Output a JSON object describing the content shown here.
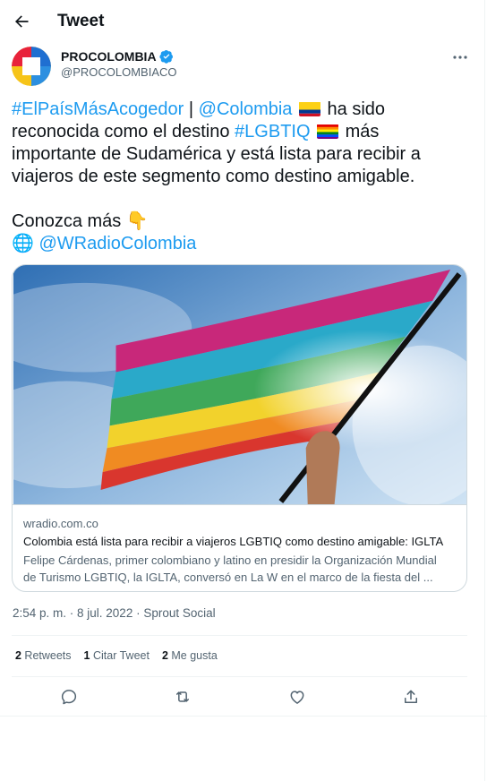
{
  "header": {
    "title": "Tweet",
    "back_icon": "arrow-left-icon"
  },
  "author": {
    "name": "PROCOLOMBIA",
    "handle": "@PROCOLOMBIACO",
    "verified": true
  },
  "tweet": {
    "l1_tag": "#ElPaísMásAcogedor",
    "l1_sep": " | ",
    "l1_mention": "@Colombia",
    "l1_tail": " ha sido",
    "l2_head": "reconocida como el destino ",
    "l2_tag": "#LGBTIQ",
    "l2_tail": " más",
    "l3": "importante de Sudamérica y está lista para recibir a",
    "l4": "viajeros de este segmento como destino amigable.",
    "l5": "Conozca más 👇",
    "l6_icon": "🌐",
    "l6_mention": "@WRadioColombia"
  },
  "card": {
    "domain": "wradio.com.co",
    "title": "Colombia está lista para recibir a viajeros LGBTIQ como destino amigable: IGLTA",
    "desc_line1": "Felipe Cárdenas, primer colombiano y latino en presidir la Organización Mundial",
    "desc_line2": "de Turismo LGBTIQ, la IGLTA, conversó en La W en el marco de la fiesta del ..."
  },
  "meta": {
    "timestamp": "2:54 p. m. · 8 jul. 2022 · Sprout Social"
  },
  "stats": {
    "retweets_count": "2",
    "retweets_label": " Retweets",
    "quotes_count": "1",
    "quotes_label": " Citar Tweet",
    "likes_count": "2",
    "likes_label": " Me gusta"
  },
  "colors": {
    "link": "#1d9bf0",
    "secondary": "#536471",
    "border": "#cfd9de"
  }
}
